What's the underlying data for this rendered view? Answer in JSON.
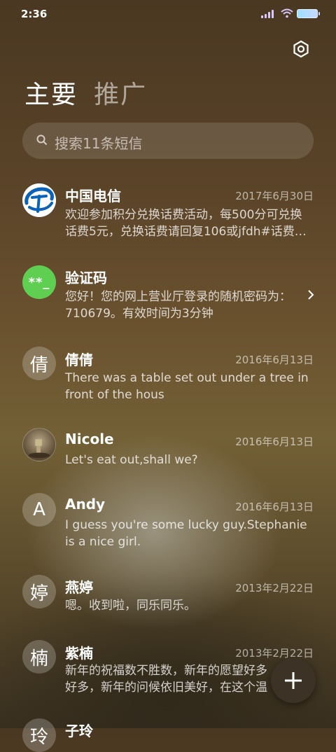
{
  "status": {
    "time": "2:36"
  },
  "tabs": [
    {
      "label": "主要"
    },
    {
      "label": "推广"
    }
  ],
  "search": {
    "placeholder": "搜索11条短信"
  },
  "messages": [
    {
      "name": "中国电信",
      "date": "2017年6月30日",
      "preview": "欢迎参加积分兑换话费活动，每500分可兑换话费5元，兑换话费请回复106或jfdh#话费…",
      "avatar_type": "telecom-logo"
    },
    {
      "name": "验证码",
      "date": "",
      "preview": "您好！您的网上营业厅登录的随机密码为：710679。有效时间为3分钟",
      "avatar_type": "code",
      "avatar_text": "**_"
    },
    {
      "name": "倩倩",
      "date": "2016年6月13日",
      "preview": "There was a table set out under a tree in front of the hous",
      "avatar_type": "letter",
      "avatar_text": "倩"
    },
    {
      "name": "Nicole",
      "date": "2016年6月13日",
      "preview": "Let's eat out,shall we?",
      "avatar_type": "photo"
    },
    {
      "name": "Andy",
      "date": "2016年6月13日",
      "preview": "I guess you're some lucky guy.Stephanie is a nice girl.",
      "avatar_type": "letter",
      "avatar_text": "A"
    },
    {
      "name": "燕婷",
      "date": "2013年2月22日",
      "preview": "嗯。收到啦，同乐同乐。",
      "avatar_type": "letter",
      "avatar_text": "婷"
    },
    {
      "name": "紫楠",
      "date": "2013年2月22日",
      "preview": "新年的祝福数不胜数，新年的愿望好多好多，新年的问候依旧美好，在这个温馨的时",
      "avatar_type": "letter",
      "avatar_text": "楠"
    },
    {
      "name": "子玲",
      "date": "",
      "preview": "",
      "avatar_type": "letter",
      "avatar_text": "玲"
    }
  ],
  "colors": {
    "code_avatar": "#5fcf52",
    "telecom_blue": "#0a63b6",
    "fab_bg": "#3d3226"
  }
}
